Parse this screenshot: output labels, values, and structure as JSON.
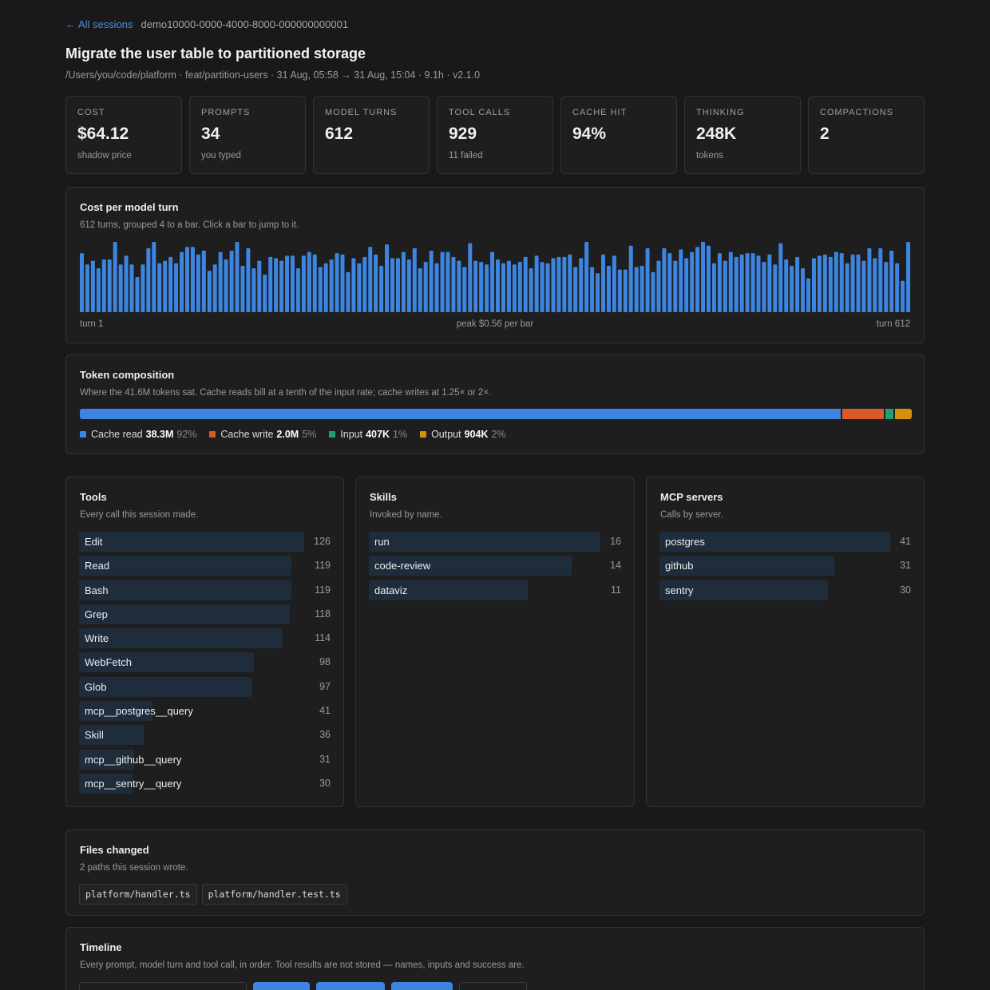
{
  "breadcrumb": {
    "back_label": "← All sessions",
    "session_id": "demo10000-0000-4000-8000-000000000001"
  },
  "title": "Migrate the user table to partitioned storage",
  "meta": "/Users/you/code/platform · feat/partition-users · 31 Aug, 05:58 → 31 Aug, 15:04 · 9.1h · v2.1.0",
  "stats": [
    {
      "label": "COST",
      "value": "$64.12",
      "sub": "shadow price"
    },
    {
      "label": "PROMPTS",
      "value": "34",
      "sub": "you typed"
    },
    {
      "label": "MODEL TURNS",
      "value": "612",
      "sub": ""
    },
    {
      "label": "TOOL CALLS",
      "value": "929",
      "sub": "11 failed"
    },
    {
      "label": "CACHE HIT",
      "value": "94%",
      "sub": ""
    },
    {
      "label": "THINKING",
      "value": "248K",
      "sub": "tokens"
    },
    {
      "label": "COMPACTIONS",
      "value": "2",
      "sub": ""
    }
  ],
  "cost_chart": {
    "title": "Cost per model turn",
    "subtitle": "612 turns, grouped 4 to a bar. Click a bar to jump to it.",
    "left_label": "turn 1",
    "mid_label": "peak $0.56 per bar",
    "right_label": "turn 612",
    "bar_color": "#3d85e0"
  },
  "chart_data": {
    "type": "bar",
    "title": "Cost per model turn",
    "peak": 0.56,
    "ylim": [
      0,
      0.56
    ],
    "values": [
      0.47,
      0.38,
      0.41,
      0.35,
      0.42,
      0.42,
      0.56,
      0.38,
      0.45,
      0.38,
      0.28,
      0.38,
      0.51,
      0.57,
      0.39,
      0.41,
      0.44,
      0.39,
      0.48,
      0.52,
      0.52,
      0.46,
      0.49,
      0.33,
      0.38,
      0.48,
      0.42,
      0.49,
      0.57,
      0.37,
      0.51,
      0.35,
      0.41,
      0.3,
      0.44,
      0.43,
      0.41,
      0.45,
      0.45,
      0.35,
      0.45,
      0.48,
      0.46,
      0.36,
      0.39,
      0.42,
      0.47,
      0.46,
      0.32,
      0.43,
      0.39,
      0.44,
      0.52,
      0.46,
      0.37,
      0.54,
      0.43,
      0.43,
      0.48,
      0.42,
      0.51,
      0.35,
      0.4,
      0.49,
      0.39,
      0.48,
      0.48,
      0.44,
      0.41,
      0.36,
      0.55,
      0.41,
      0.4,
      0.38,
      0.48,
      0.42,
      0.39,
      0.41,
      0.38,
      0.4,
      0.44,
      0.35,
      0.45,
      0.4,
      0.39,
      0.43,
      0.44,
      0.44,
      0.46,
      0.36,
      0.43,
      0.57,
      0.36,
      0.31,
      0.46,
      0.37,
      0.45,
      0.34,
      0.34,
      0.53,
      0.36,
      0.37,
      0.51,
      0.32,
      0.41,
      0.51,
      0.47,
      0.41,
      0.5,
      0.43,
      0.48,
      0.52,
      0.57,
      0.53,
      0.39,
      0.47,
      0.41,
      0.48,
      0.44,
      0.46,
      0.47,
      0.47,
      0.45,
      0.4,
      0.46,
      0.38,
      0.55,
      0.42,
      0.37,
      0.44,
      0.35,
      0.27,
      0.43,
      0.45,
      0.46,
      0.44,
      0.48,
      0.47,
      0.39,
      0.46,
      0.46,
      0.41,
      0.51,
      0.43,
      0.51,
      0.4,
      0.49,
      0.39,
      0.25,
      0.56
    ]
  },
  "tokens": {
    "title": "Token composition",
    "subtitle": "Where the 41.6M tokens sat. Cache reads bill at a tenth of the input rate; cache writes at 1.25× or 2×.",
    "segments": [
      {
        "label": "Cache read",
        "value": "38.3M",
        "pct": "92%",
        "share": 92,
        "color": "#3d85e0"
      },
      {
        "label": "Cache write",
        "value": "2.0M",
        "pct": "5%",
        "share": 5,
        "color": "#d95b2b"
      },
      {
        "label": "Input",
        "value": "407K",
        "pct": "1%",
        "share": 1,
        "color": "#22a06b"
      },
      {
        "label": "Output",
        "value": "904K",
        "pct": "2%",
        "share": 2,
        "color": "#d48f0d"
      }
    ]
  },
  "tools": {
    "title": "Tools",
    "subtitle": "Every call this session made.",
    "max": 126,
    "items": [
      {
        "name": "Edit",
        "count": 126
      },
      {
        "name": "Read",
        "count": 119
      },
      {
        "name": "Bash",
        "count": 119
      },
      {
        "name": "Grep",
        "count": 118
      },
      {
        "name": "Write",
        "count": 114
      },
      {
        "name": "WebFetch",
        "count": 98
      },
      {
        "name": "Glob",
        "count": 97
      },
      {
        "name": "mcp__postgres__query",
        "count": 41
      },
      {
        "name": "Skill",
        "count": 36
      },
      {
        "name": "mcp__github__query",
        "count": 31
      },
      {
        "name": "mcp__sentry__query",
        "count": 30
      }
    ]
  },
  "skills": {
    "title": "Skills",
    "subtitle": "Invoked by name.",
    "max": 16,
    "items": [
      {
        "name": "run",
        "count": 16
      },
      {
        "name": "code-review",
        "count": 14
      },
      {
        "name": "dataviz",
        "count": 11
      }
    ]
  },
  "mcp": {
    "title": "MCP servers",
    "subtitle": "Calls by server.",
    "max": 41,
    "items": [
      {
        "name": "postgres",
        "count": 41
      },
      {
        "name": "github",
        "count": 31
      },
      {
        "name": "sentry",
        "count": 30
      }
    ]
  },
  "files": {
    "title": "Files changed",
    "subtitle": "2 paths this session wrote.",
    "paths": [
      "platform/handler.ts",
      "platform/handler.test.ts"
    ]
  },
  "timeline": {
    "title": "Timeline",
    "subtitle": "Every prompt, model turn and tool call, in order. Tool results are not stored — names, inputs and success are."
  }
}
